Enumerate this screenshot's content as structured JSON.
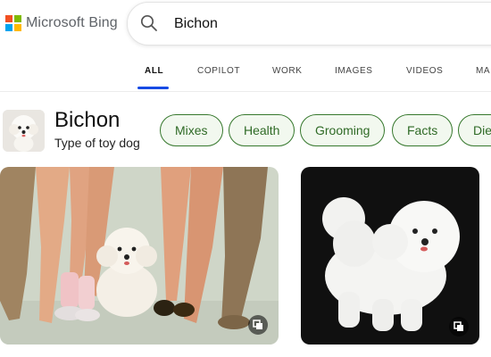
{
  "brand": {
    "name": "Microsoft Bing",
    "colors": [
      "#f25022",
      "#7fba00",
      "#00a4ef",
      "#ffb900"
    ]
  },
  "search": {
    "query": "Bichon",
    "icon": "search-icon"
  },
  "tabs": [
    {
      "label": "ALL",
      "active": true
    },
    {
      "label": "COPILOT",
      "active": false
    },
    {
      "label": "WORK",
      "active": false
    },
    {
      "label": "IMAGES",
      "active": false
    },
    {
      "label": "VIDEOS",
      "active": false
    },
    {
      "label": "MAP",
      "active": false
    }
  ],
  "entity": {
    "title": "Bichon",
    "subtitle": "Type of toy dog"
  },
  "chips": [
    "Mixes",
    "Health",
    "Grooming",
    "Facts",
    "Diet"
  ],
  "images": [
    {
      "subject": "bichon with women's legs in leopard stockings",
      "icon": "expand-icon"
    },
    {
      "subject": "white bichon frise on black background",
      "icon": "expand-icon"
    }
  ],
  "accent": "#174ae4"
}
